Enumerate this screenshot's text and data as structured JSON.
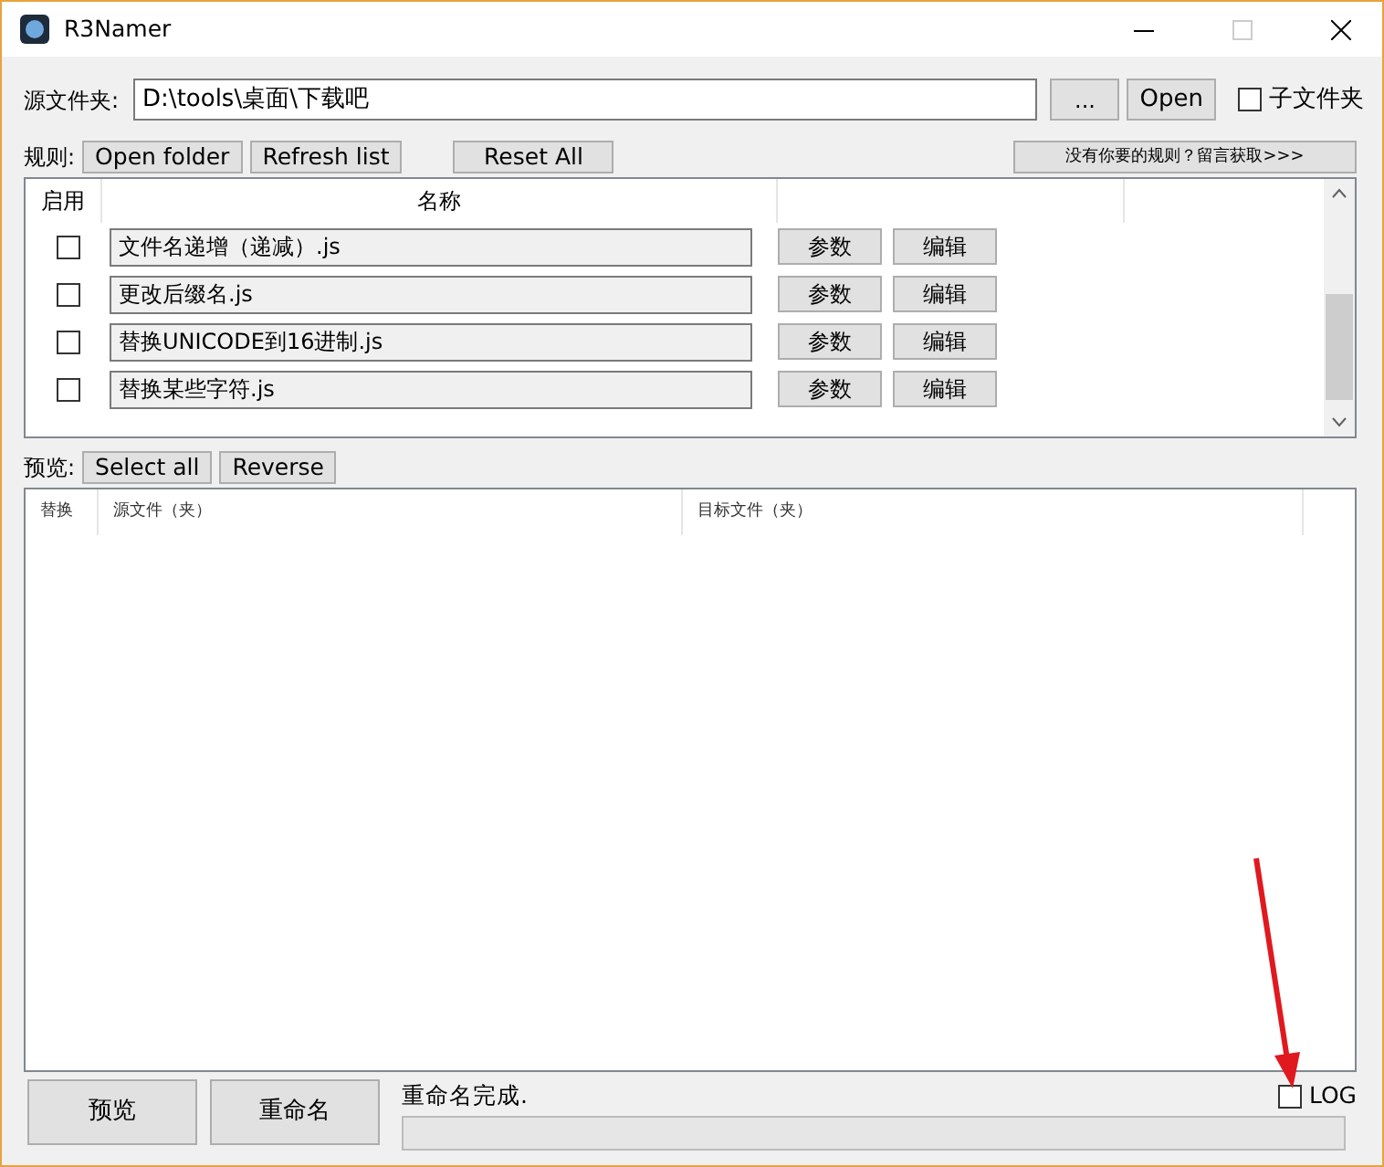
{
  "window": {
    "title": "R3Namer"
  },
  "source": {
    "label": "源文件夹:",
    "value": "D:\\tools\\桌面\\下载吧",
    "browse_button": "...",
    "open_button": "Open",
    "subfolders": {
      "label": "子文件夹",
      "checked": false
    }
  },
  "rules_bar": {
    "label": "规则:",
    "buttons": [
      "Open folder",
      "Refresh list",
      "Reset All"
    ],
    "more_button": "没有你要的规则？留言获取>>>"
  },
  "rules": {
    "columns": [
      "启用",
      "名称"
    ],
    "rows": [
      {
        "checked": false,
        "name": "文件名递增（递减）.js",
        "params": "参数",
        "edit": "编辑"
      },
      {
        "checked": false,
        "name": "更改后缀名.js",
        "params": "参数",
        "edit": "编辑"
      },
      {
        "checked": false,
        "name": "替换UNICODE到16进制.js",
        "params": "参数",
        "edit": "编辑"
      },
      {
        "checked": false,
        "name": "替换某些字符.js",
        "params": "参数",
        "edit": "编辑"
      }
    ]
  },
  "preview_bar": {
    "label": "预览:",
    "buttons": [
      "Select all",
      "Reverse"
    ]
  },
  "preview": {
    "columns": [
      "替换",
      "源文件（夹）",
      "目标文件（夹）"
    ]
  },
  "bottom": {
    "preview_button": "预览",
    "rename_button": "重命名",
    "status": "重命名完成.",
    "progress": {
      "level": 0
    },
    "log": {
      "label": "LOG",
      "checked": false
    }
  }
}
